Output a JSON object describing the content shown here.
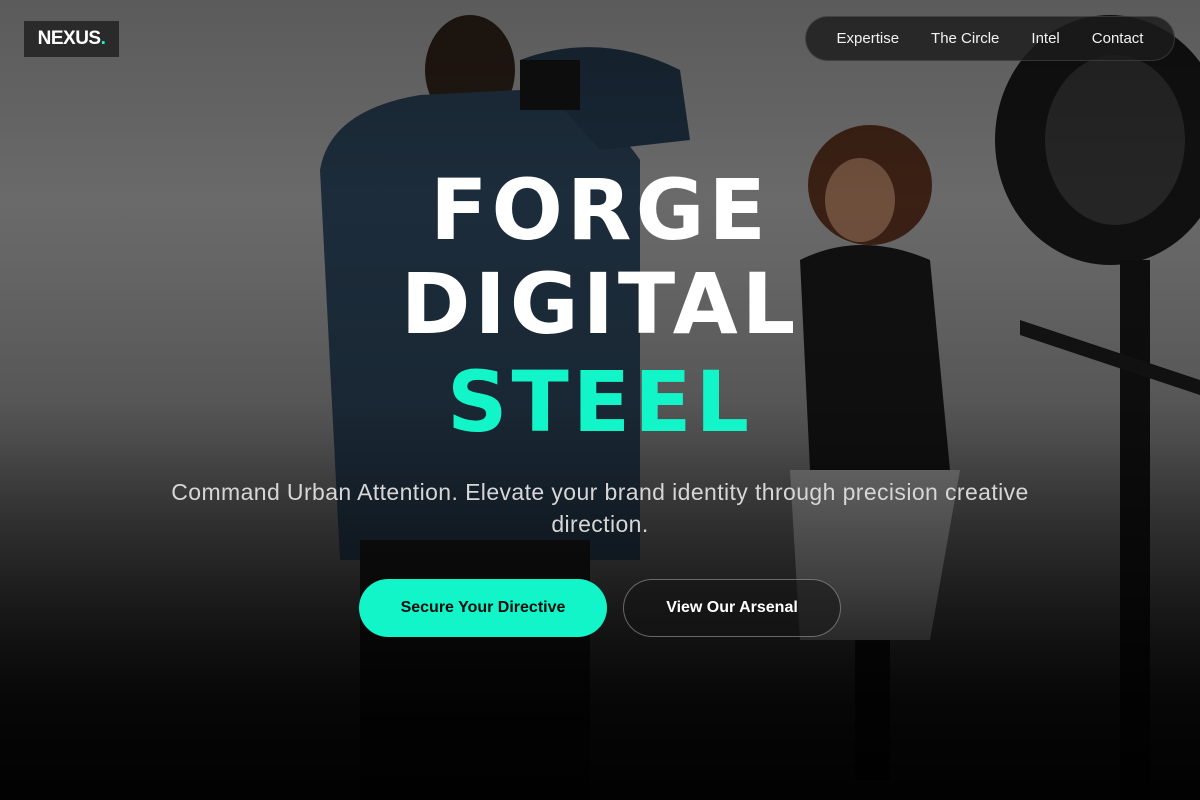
{
  "brand": {
    "name": "NEXUS",
    "dot": ".",
    "accent_color": "#12f5c9"
  },
  "nav": {
    "items": [
      {
        "label": "Expertise"
      },
      {
        "label": "The Circle"
      },
      {
        "label": "Intel"
      },
      {
        "label": "Contact"
      }
    ]
  },
  "hero": {
    "headline_line1": "FORGE",
    "headline_line2": "DIGITAL",
    "headline_line3": "STEEL",
    "subtitle": "Command Urban Attention. Elevate your brand identity through precision creative direction.",
    "primary_button": "Secure Your Directive",
    "secondary_button": "View Our Arsenal"
  }
}
